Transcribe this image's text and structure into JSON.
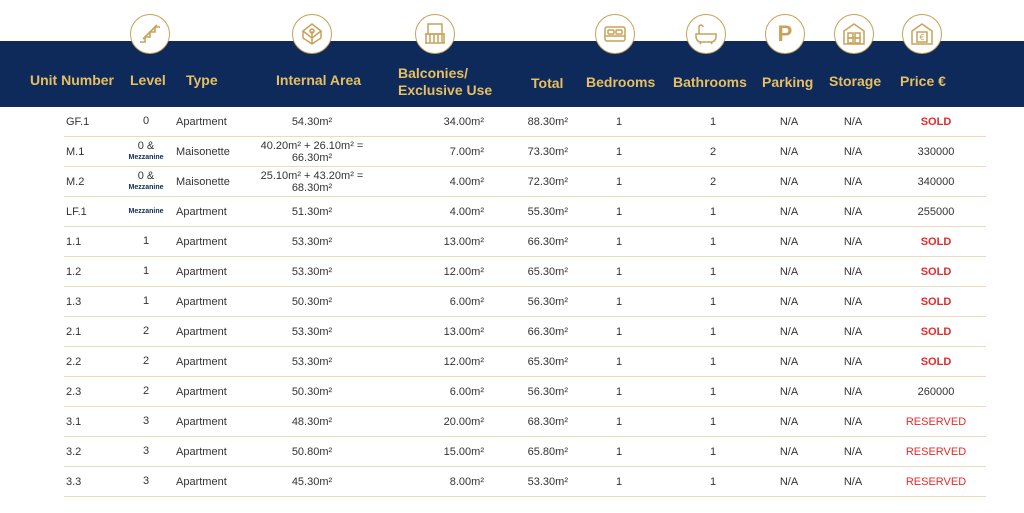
{
  "colors": {
    "header_bg": "#0e2a5a",
    "header_text": "#e7bf62",
    "icon_gold": "#c9a158",
    "sold": "#e32b2b",
    "row_divider": "#e9dcbc"
  },
  "header": {
    "unit_number": "Unit Number",
    "level": "Level",
    "type": "Type",
    "internal_area": "Internal Area",
    "balconies_line1": "Balconies/",
    "balconies_line2": "Exclusive Use",
    "total": "Total",
    "bedrooms": "Bedrooms",
    "bathrooms": "Bathrooms",
    "parking": "Parking",
    "storage": "Storage",
    "price": "Price €"
  },
  "icons": {
    "level": "stairs-icon",
    "area": "floor-plan-icon",
    "balcony": "balcony-icon",
    "bedroom": "bed-icon",
    "bathroom": "bathtub-icon",
    "parking": "parking-icon",
    "parking_letter": "P",
    "storage": "storage-icon",
    "price": "price-icon"
  },
  "rows": [
    {
      "unit": "GF.1",
      "level": "0",
      "level_sub": "",
      "type": "Apartment",
      "area": "54.30m²",
      "balcony": "34.00m²",
      "total": "88.30m²",
      "bedrooms": "1",
      "bathrooms": "1",
      "parking": "N/A",
      "storage": "N/A",
      "price": "SOLD",
      "status": "sold"
    },
    {
      "unit": "M.1",
      "level": "0 &",
      "level_sub": "Mezzanine",
      "type": "Maisonette",
      "area": "40.20m² + 26.10m² = 66.30m²",
      "balcony": "7.00m²",
      "total": "73.30m²",
      "bedrooms": "1",
      "bathrooms": "2",
      "parking": "N/A",
      "storage": "N/A",
      "price": "330000",
      "status": "avail"
    },
    {
      "unit": "M.2",
      "level": "0 &",
      "level_sub": "Mezzanine",
      "type": "Maisonette",
      "area": "25.10m² + 43.20m² = 68.30m²",
      "balcony": "4.00m²",
      "total": "72.30m²",
      "bedrooms": "1",
      "bathrooms": "2",
      "parking": "N/A",
      "storage": "N/A",
      "price": "340000",
      "status": "avail"
    },
    {
      "unit": "LF.1",
      "level": "",
      "level_sub": "Mezzanine",
      "type": "Apartment",
      "area": "51.30m²",
      "balcony": "4.00m²",
      "total": "55.30m²",
      "bedrooms": "1",
      "bathrooms": "1",
      "parking": "N/A",
      "storage": "N/A",
      "price": "255000",
      "status": "avail"
    },
    {
      "unit": "1.1",
      "level": "1",
      "level_sub": "",
      "type": "Apartment",
      "area": "53.30m²",
      "balcony": "13.00m²",
      "total": "66.30m²",
      "bedrooms": "1",
      "bathrooms": "1",
      "parking": "N/A",
      "storage": "N/A",
      "price": "SOLD",
      "status": "sold"
    },
    {
      "unit": "1.2",
      "level": "1",
      "level_sub": "",
      "type": "Apartment",
      "area": "53.30m²",
      "balcony": "12.00m²",
      "total": "65.30m²",
      "bedrooms": "1",
      "bathrooms": "1",
      "parking": "N/A",
      "storage": "N/A",
      "price": "SOLD",
      "status": "sold"
    },
    {
      "unit": "1.3",
      "level": "1",
      "level_sub": "",
      "type": "Apartment",
      "area": "50.30m²",
      "balcony": "6.00m²",
      "total": "56.30m²",
      "bedrooms": "1",
      "bathrooms": "1",
      "parking": "N/A",
      "storage": "N/A",
      "price": "SOLD",
      "status": "sold"
    },
    {
      "unit": "2.1",
      "level": "2",
      "level_sub": "",
      "type": "Apartment",
      "area": "53.30m²",
      "balcony": "13.00m²",
      "total": "66.30m²",
      "bedrooms": "1",
      "bathrooms": "1",
      "parking": "N/A",
      "storage": "N/A",
      "price": "SOLD",
      "status": "sold"
    },
    {
      "unit": "2.2",
      "level": "2",
      "level_sub": "",
      "type": "Apartment",
      "area": "53.30m²",
      "balcony": "12.00m²",
      "total": "65.30m²",
      "bedrooms": "1",
      "bathrooms": "1",
      "parking": "N/A",
      "storage": "N/A",
      "price": "SOLD",
      "status": "sold"
    },
    {
      "unit": "2.3",
      "level": "2",
      "level_sub": "",
      "type": "Apartment",
      "area": "50.30m²",
      "balcony": "6.00m²",
      "total": "56.30m²",
      "bedrooms": "1",
      "bathrooms": "1",
      "parking": "N/A",
      "storage": "N/A",
      "price": "260000",
      "status": "avail"
    },
    {
      "unit": "3.1",
      "level": "3",
      "level_sub": "",
      "type": "Apartment",
      "area": "48.30m²",
      "balcony": "20.00m²",
      "total": "68.30m²",
      "bedrooms": "1",
      "bathrooms": "1",
      "parking": "N/A",
      "storage": "N/A",
      "price": "RESERVED",
      "status": "reserved"
    },
    {
      "unit": "3.2",
      "level": "3",
      "level_sub": "",
      "type": "Apartment",
      "area": "50.80m²",
      "balcony": "15.00m²",
      "total": "65.80m²",
      "bedrooms": "1",
      "bathrooms": "1",
      "parking": "N/A",
      "storage": "N/A",
      "price": "RESERVED",
      "status": "reserved"
    },
    {
      "unit": "3.3",
      "level": "3",
      "level_sub": "",
      "type": "Apartment",
      "area": "45.30m²",
      "balcony": "8.00m²",
      "total": "53.30m²",
      "bedrooms": "1",
      "bathrooms": "1",
      "parking": "N/A",
      "storage": "N/A",
      "price": "RESERVED",
      "status": "reserved"
    }
  ]
}
